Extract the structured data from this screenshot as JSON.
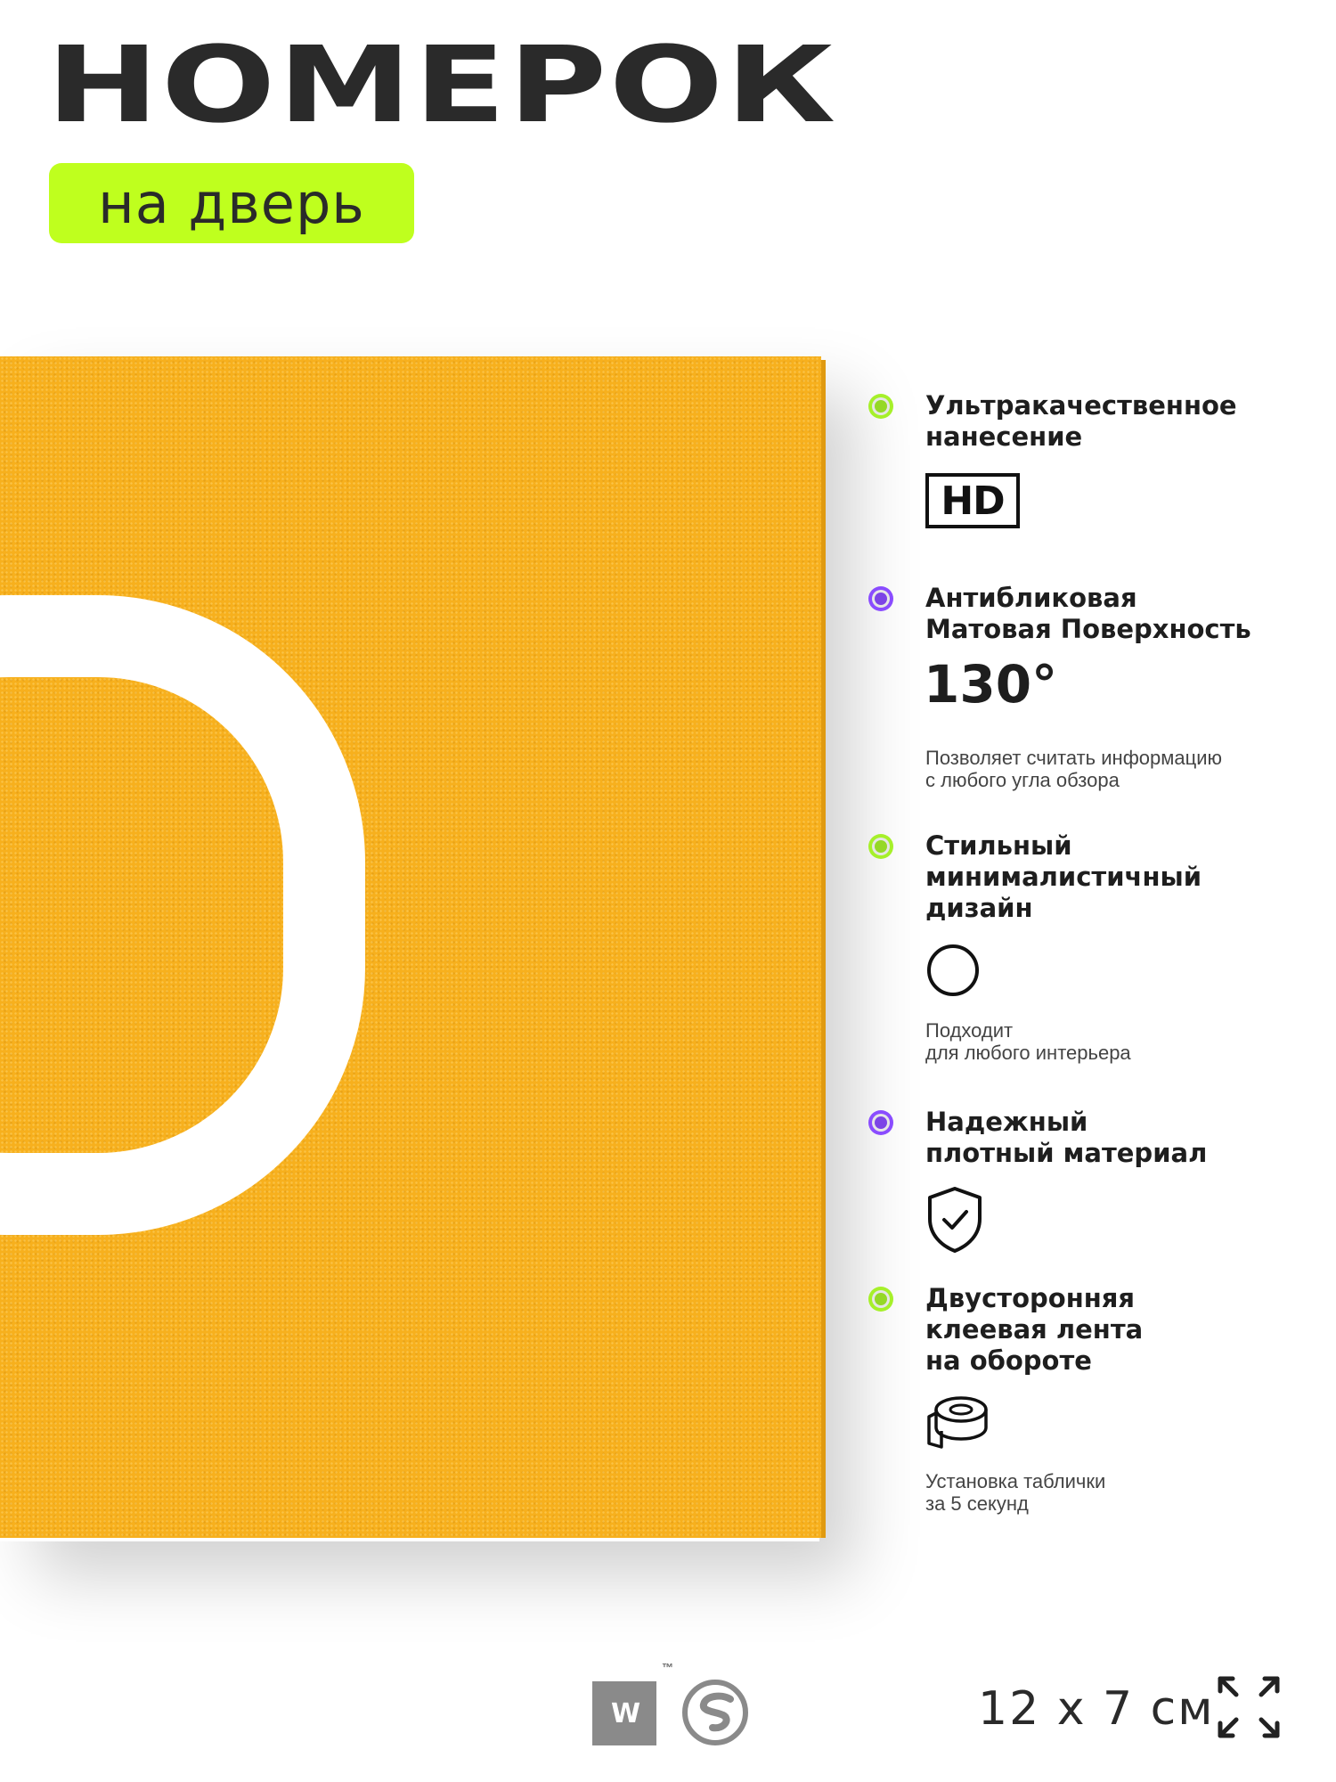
{
  "header": {
    "title": "НОМЕРОК",
    "subtitle": "на дверь"
  },
  "colors": {
    "accent_green": "#bfff1e",
    "plate_yellow": "#f7b01d",
    "bullet_green": "#a6f02a",
    "bullet_purple": "#8a4cff"
  },
  "features": [
    {
      "bullet": "green",
      "heading": [
        "Ультракачественное",
        "нанесение"
      ],
      "badge": "HD",
      "note": []
    },
    {
      "bullet": "purple",
      "heading": [
        "Антибликовая",
        "Матовая Поверхность"
      ],
      "badge": "130°",
      "note": [
        "Позволяет считать информацию",
        "с любого угла обзора"
      ]
    },
    {
      "bullet": "green",
      "heading": [
        "Стильный",
        "минималистичный",
        "дизайн"
      ],
      "icon": "circle-icon",
      "note": [
        "Подходит",
        "для любого интерьера"
      ]
    },
    {
      "bullet": "purple",
      "heading": [
        "Надежный",
        "плотный материал"
      ],
      "icon": "shield-check-icon",
      "note": []
    },
    {
      "bullet": "green",
      "heading": [
        "Двусторонняя",
        "клеевая лента",
        "на обороте"
      ],
      "icon": "tape-roll-icon",
      "note": [
        "Установка таблички",
        "за 5 секунд"
      ]
    }
  ],
  "footer": {
    "logo_mark": "W",
    "trademark": "™",
    "size": "12 x 7 см",
    "size_icon": "expand-arrows-icon"
  }
}
